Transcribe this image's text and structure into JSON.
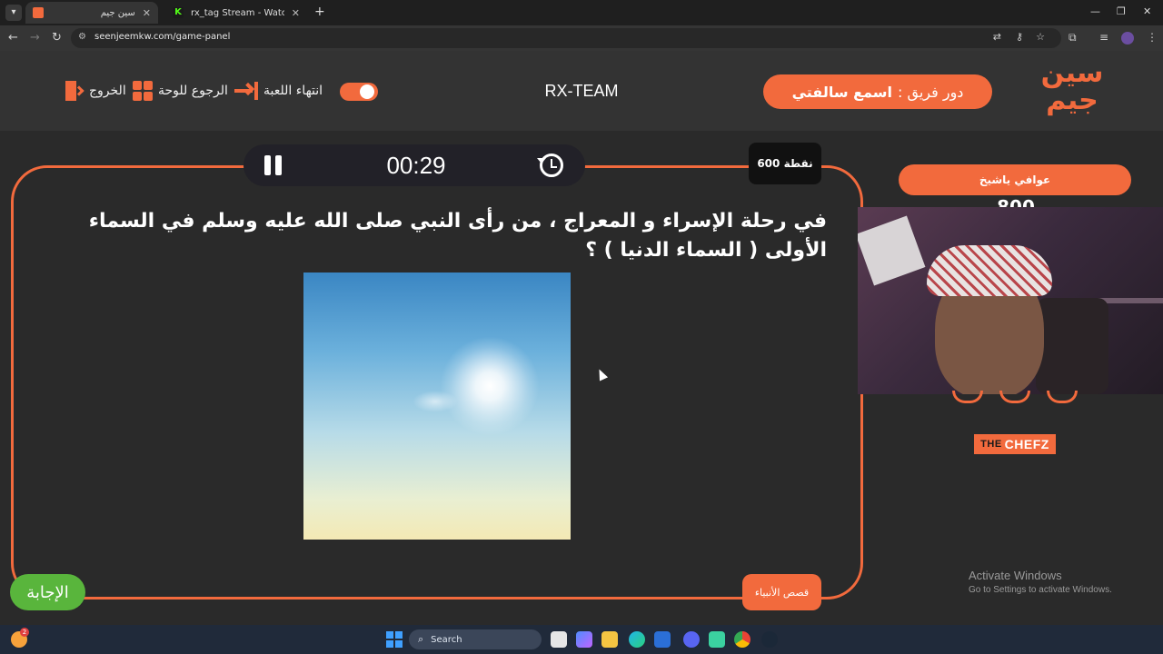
{
  "browser": {
    "tabs": [
      {
        "title": "سين جيم",
        "active": true,
        "favicon_color": "#f26a3d"
      },
      {
        "title": "rx_tag Stream - Watch Live on K",
        "active": false,
        "favicon_color": "#53fc18"
      }
    ],
    "new_tab_label": "+",
    "url": "seenjeemkw.com/game-panel"
  },
  "header": {
    "exit_label": "الخروج",
    "back_to_board_label": "الرجوع للوحة",
    "end_game_label": "انتهاء اللعبة",
    "team_name": "RX-TEAM",
    "turn_prefix": "دور فريق :",
    "turn_team": "اسمع سالفتي",
    "logo_line1": "سين",
    "logo_line2": "جيم"
  },
  "question_panel": {
    "timer": "00:29",
    "points": "600 نقطة",
    "question_text": "في رحلة الإسراء و المعراج ، من رأى النبي صلى الله عليه وسلم في السماء الأولى ( السماء الدنيا ) ؟",
    "answer_label": "الإجابة",
    "category_label": "قصص الأنبياء"
  },
  "sidebar": {
    "team_label": "عوافي ياشيخ",
    "team_score": "800",
    "sponsor_the": "THE",
    "sponsor_name": "CHEFZ"
  },
  "windows_watermark": {
    "line1": "Activate Windows",
    "line2": "Go to Settings to activate Windows."
  },
  "taskbar": {
    "search_placeholder": "Search",
    "notification_count": "2"
  },
  "colors": {
    "accent": "#f26a3d",
    "answer_green": "#59b53c",
    "background": "#2a2a2a"
  }
}
